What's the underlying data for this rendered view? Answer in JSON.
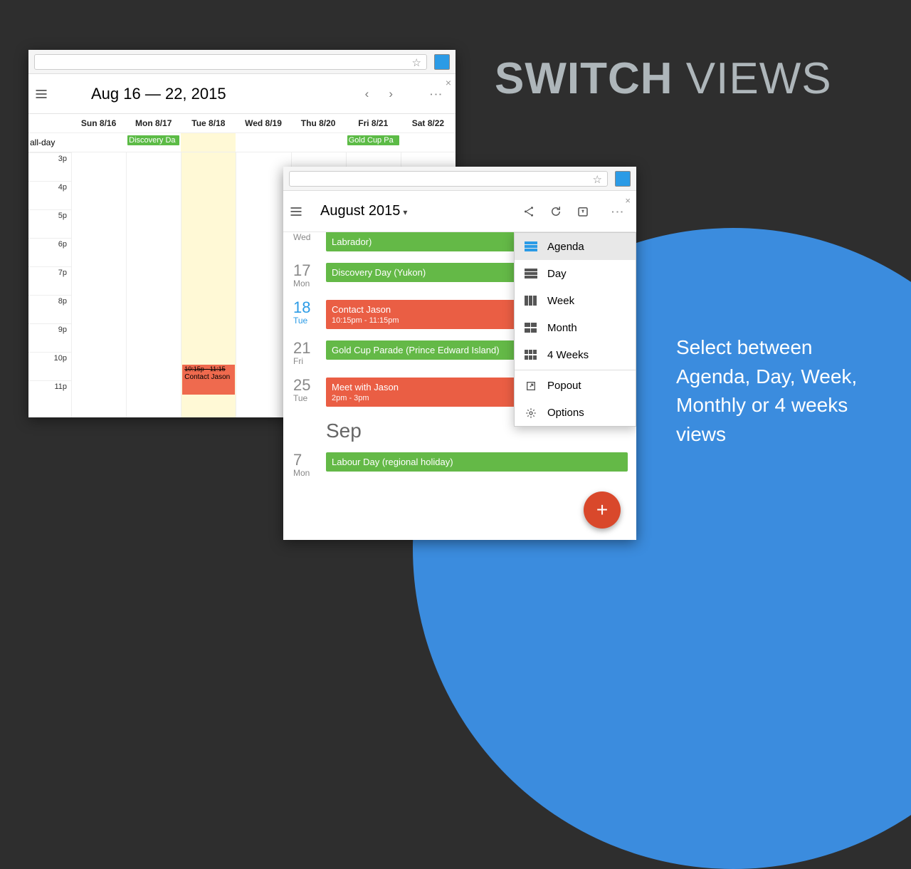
{
  "promo": {
    "title_bold": "SWITCH",
    "title_light": "VIEWS",
    "body": "Select between Agenda, Day, Week, Monthly or 4 weeks views"
  },
  "week_window": {
    "title": "Aug 16 — 22, 2015",
    "allday_label": "all-day",
    "days": [
      "Sun 8/16",
      "Mon 8/17",
      "Tue 8/18",
      "Wed 8/19",
      "Thu 8/20",
      "Fri 8/21",
      "Sat 8/22"
    ],
    "hours": [
      "3p",
      "4p",
      "5p",
      "6p",
      "7p",
      "8p",
      "9p",
      "10p",
      "11p"
    ],
    "allday_events": {
      "mon": "Discovery Da",
      "fri": "Gold Cup Pa"
    },
    "event_red": {
      "time": "10:15p - 11:15",
      "title": "Contact Jason"
    }
  },
  "agenda_window": {
    "title": "August 2015",
    "cut_event": "Labrador)",
    "cut_day_label": "Wed",
    "rows": [
      {
        "num": "17",
        "dow": "Mon",
        "color": "green",
        "title": "Discovery Day (Yukon)",
        "sub": "",
        "today": false
      },
      {
        "num": "18",
        "dow": "Tue",
        "color": "orange",
        "title": "Contact Jason",
        "sub": "10:15pm - 11:15pm",
        "today": true
      },
      {
        "num": "21",
        "dow": "Fri",
        "color": "green",
        "title": "Gold Cup Parade (Prince Edward Island)",
        "sub": "",
        "today": false
      },
      {
        "num": "25",
        "dow": "Tue",
        "color": "orange",
        "title": "Meet with Jason",
        "sub": "2pm - 3pm",
        "today": false
      }
    ],
    "next_month": "Sep",
    "sep_row": {
      "num": "7",
      "dow": "Mon",
      "color": "green",
      "title": "Labour Day (regional holiday)"
    }
  },
  "menu": {
    "items": [
      "Agenda",
      "Day",
      "Week",
      "Month",
      "4 Weeks"
    ],
    "extra": [
      "Popout",
      "Options"
    ],
    "selected": "Agenda"
  }
}
